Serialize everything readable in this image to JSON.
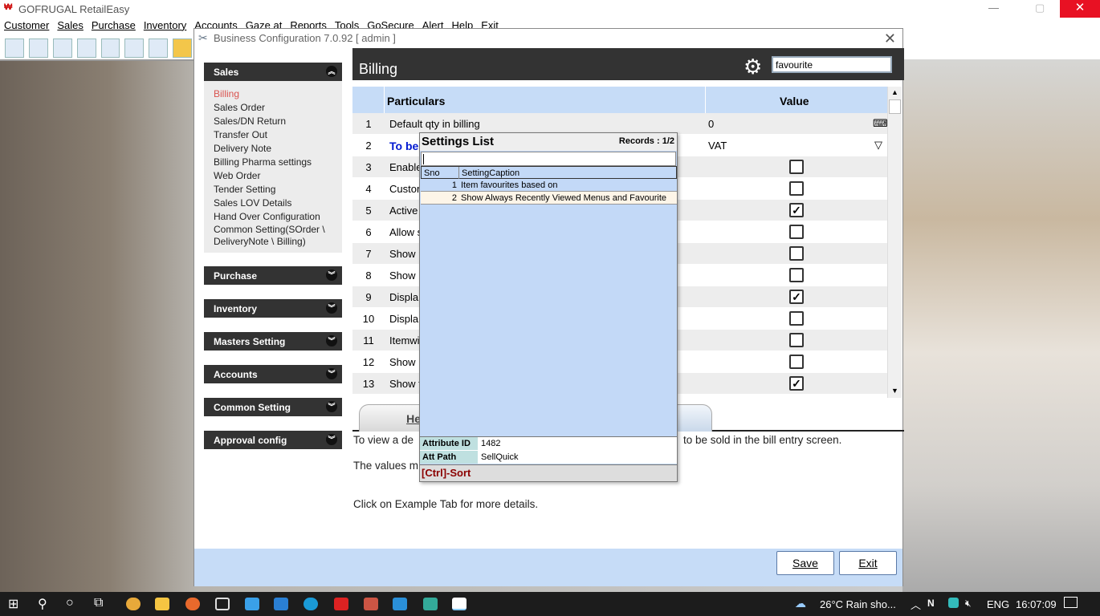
{
  "app": {
    "title": "GOFRUGAL RetailEasy"
  },
  "menu": [
    "Customer",
    "Sales",
    "Purchase",
    "Inventory",
    "Accounts",
    "Gaze at",
    "Reports",
    "Tools",
    "GoSecure",
    "Alert",
    "Help",
    "Exit"
  ],
  "dialog": {
    "title": "Business Configuration 7.0.92 [ admin ]",
    "sidebar": {
      "expanded": "Sales",
      "items": [
        "Billing",
        "Sales Order",
        "Sales/DN Return",
        "Transfer Out",
        "Delivery Note",
        "Billing Pharma settings",
        "Web Order",
        "Tender Setting",
        "Sales LOV Details",
        "Hand Over Configuration",
        "Common Setting(SOrder \\",
        "DeliveryNote \\ Billing)"
      ],
      "sections": [
        "Purchase",
        "Inventory",
        "Masters Setting",
        "Accounts",
        "Common Setting",
        "Approval config"
      ]
    },
    "main": {
      "title": "Billing",
      "search_value": "favourite",
      "columns": {
        "particulars": "Particulars",
        "value": "Value"
      },
      "rows": [
        {
          "n": "1",
          "p": "Default qty in  billing",
          "v": "0",
          "type": "text"
        },
        {
          "n": "2",
          "p": "To be",
          "v": "VAT",
          "type": "select"
        },
        {
          "n": "3",
          "p": "Enable",
          "checked": false
        },
        {
          "n": "4",
          "p": "Custor",
          "checked": false
        },
        {
          "n": "5",
          "p": "Active",
          "checked": true
        },
        {
          "n": "6",
          "p": "Allow s",
          "checked": false
        },
        {
          "n": "7",
          "p": "Show p",
          "checked": false
        },
        {
          "n": "8",
          "p": "Show l",
          "checked": false
        },
        {
          "n": "9",
          "p": "Displa",
          "checked": true
        },
        {
          "n": "10",
          "p": "Displa",
          "checked": false
        },
        {
          "n": "11",
          "p": "Itemwi",
          "checked": false
        },
        {
          "n": "12",
          "p": "Show r",
          "checked": false
        },
        {
          "n": "13",
          "p": "Show t",
          "checked": true
        }
      ],
      "tab_help": "Hel",
      "help_lines": [
        "To view a de",
        "to be sold  in the bill entry screen.",
        "The values m",
        "Click on Example Tab for more details."
      ],
      "save": "Save",
      "exit": "Exit"
    }
  },
  "popup": {
    "title": "Settings List",
    "records": "Records : 1/2",
    "col_sno": "Sno",
    "col_caption": "SettingCaption",
    "rows": [
      {
        "sno": "1",
        "caption": "Item favourites based on"
      },
      {
        "sno": "2",
        "caption": "Show Always Recently Viewed Menus and Favourite"
      }
    ],
    "attr_id_label": "Attribute ID",
    "attr_id": "1482",
    "att_path_label": "Att Path",
    "att_path": "SellQuick",
    "sort_hint": "[Ctrl]-Sort"
  },
  "taskbar": {
    "weather": "26°C  Rain sho...",
    "lang": "ENG",
    "time": "16:07:09"
  }
}
